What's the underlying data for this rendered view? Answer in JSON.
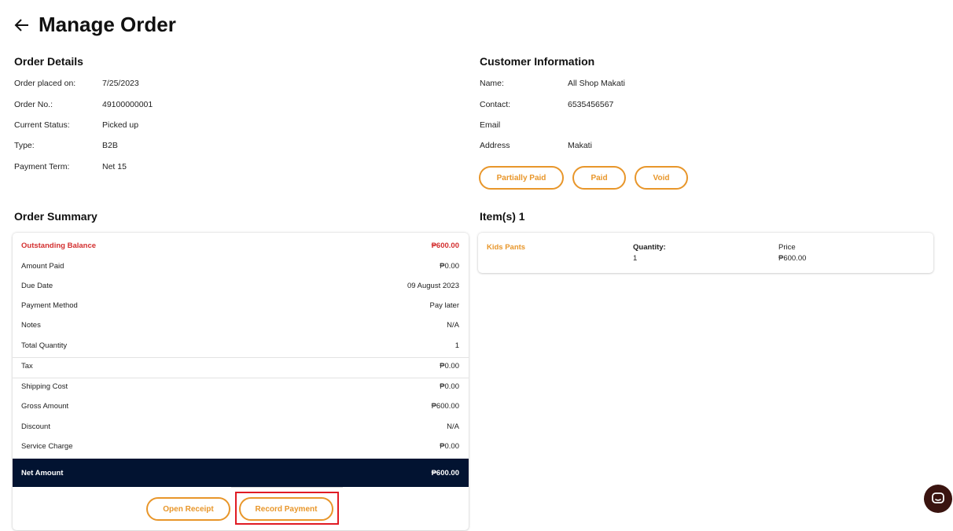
{
  "header": {
    "title": "Manage Order"
  },
  "order_details": {
    "title": "Order Details",
    "rows": [
      {
        "label": "Order placed on:",
        "value": "7/25/2023"
      },
      {
        "label": "Order No.:",
        "value": "49100000001"
      },
      {
        "label": "Current Status:",
        "value": "Picked up"
      },
      {
        "label": "Type:",
        "value": "B2B"
      },
      {
        "label": "Payment Term:",
        "value": "Net 15"
      }
    ]
  },
  "customer": {
    "title": "Customer Information",
    "rows": [
      {
        "label": "Name:",
        "value": "All Shop Makati"
      },
      {
        "label": "Contact:",
        "value": "6535456567"
      },
      {
        "label": "Email",
        "value": ""
      },
      {
        "label": "Address",
        "value": "Makati"
      }
    ],
    "buttons": {
      "partially_paid": "Partially Paid",
      "paid": "Paid",
      "void": "Void"
    }
  },
  "order_summary": {
    "title": "Order Summary",
    "rows": [
      {
        "label": "Outstanding Balance",
        "value": "₱600.00"
      },
      {
        "label": "Amount Paid",
        "value": "₱0.00"
      },
      {
        "label": "Due Date",
        "value": "09 August 2023"
      },
      {
        "label": "Payment Method",
        "value": "Pay later"
      },
      {
        "label": "Notes",
        "value": "N/A"
      },
      {
        "label": "Total Quantity",
        "value": "1"
      },
      {
        "label": "Tax",
        "value": "₱0.00"
      },
      {
        "label": "Shipping Cost",
        "value": "₱0.00"
      },
      {
        "label": "Gross Amount",
        "value": "₱600.00"
      },
      {
        "label": "Discount",
        "value": "N/A"
      },
      {
        "label": "Service Charge",
        "value": "₱0.00"
      }
    ],
    "net": {
      "label": "Net Amount",
      "value": "₱600.00"
    },
    "buttons": {
      "open_receipt": "Open Receipt",
      "record_payment": "Record Payment"
    }
  },
  "items": {
    "title": "Item(s) 1",
    "list": [
      {
        "name": "Kids Pants",
        "quantity_label": "Quantity:",
        "quantity": "1",
        "price_label": "Price",
        "price": "₱600.00"
      }
    ]
  },
  "colors": {
    "accent": "#e8962a",
    "alert": "#d32f2f",
    "net_bar": "#021331",
    "highlight": "#e01b24"
  },
  "icons": {
    "back": "arrow-left-icon",
    "chat": "chat-bubble-icon"
  }
}
